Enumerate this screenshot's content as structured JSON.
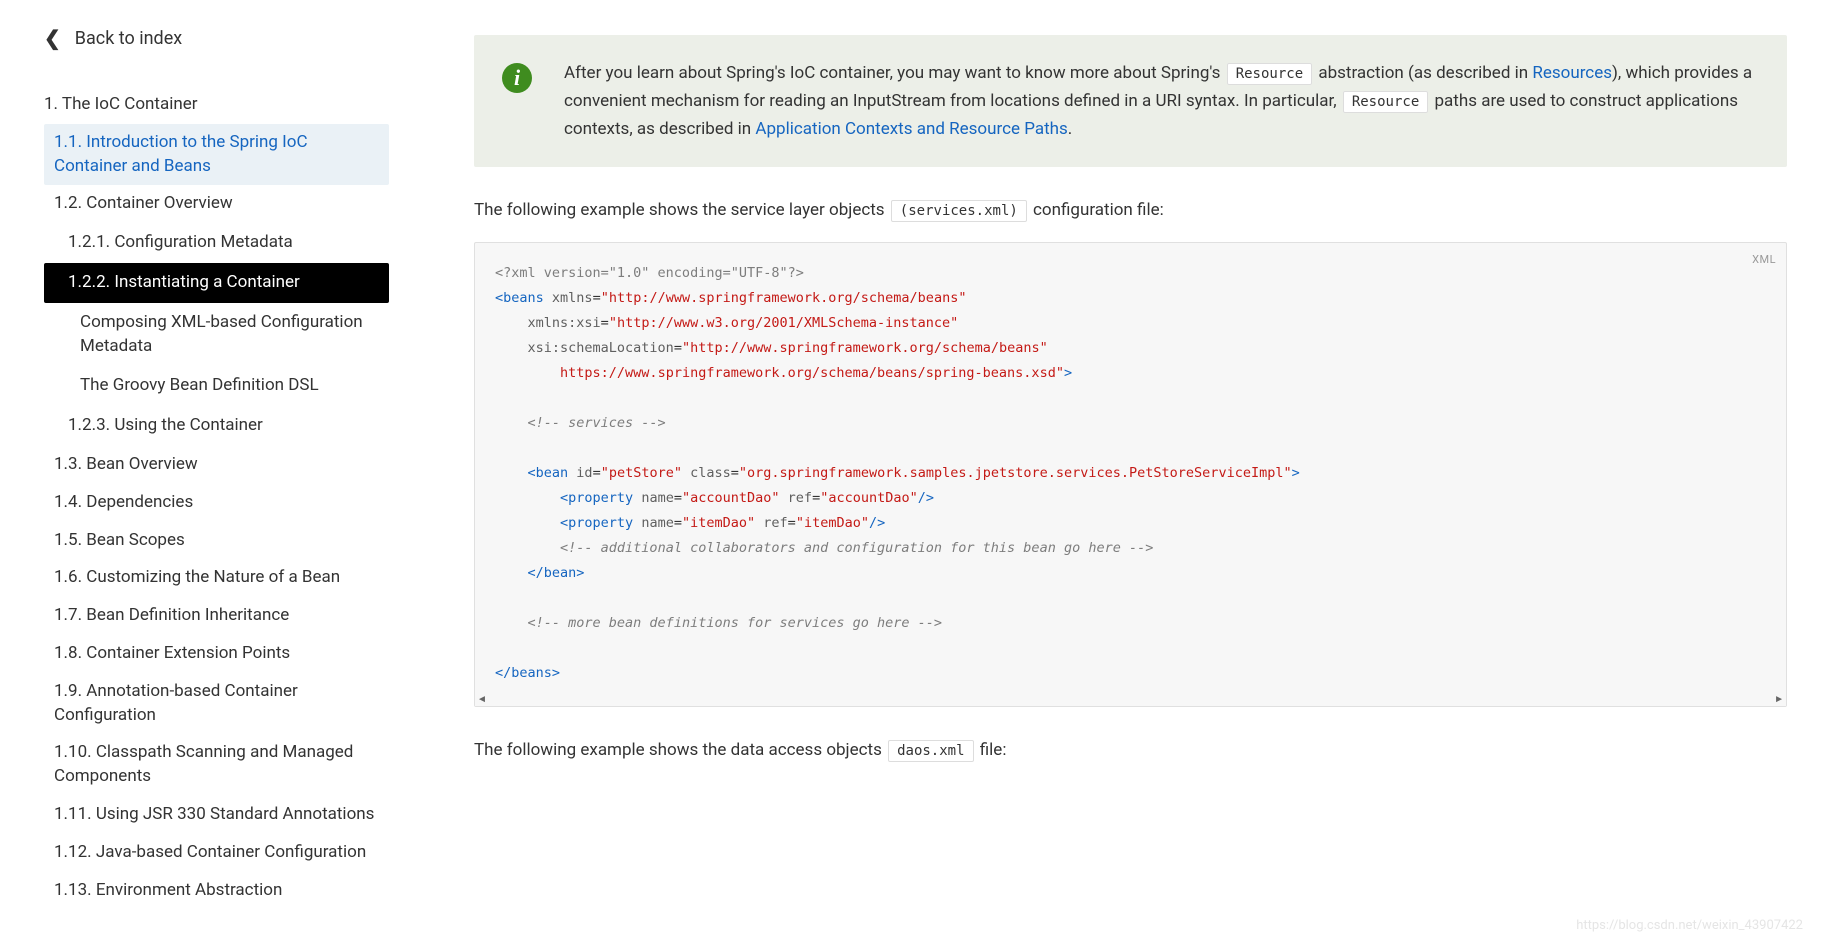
{
  "sidebar": {
    "back_label": "Back to index",
    "items": [
      {
        "label": "1. The IoC Container",
        "level": 0,
        "active": false
      },
      {
        "label": "1.1. Introduction to the Spring IoC Container and Beans",
        "level": 1,
        "active": false,
        "highlight": true
      },
      {
        "label": "1.2. Container Overview",
        "level": 1,
        "active": false
      },
      {
        "label": "1.2.1. Configuration Metadata",
        "level": 2,
        "active": false
      },
      {
        "label": "1.2.2. Instantiating a Container",
        "level": 2,
        "active": true
      },
      {
        "label": "Composing XML-based Configuration Metadata",
        "level": 3,
        "active": false
      },
      {
        "label": "The Groovy Bean Definition DSL",
        "level": 3,
        "active": false
      },
      {
        "label": "1.2.3. Using the Container",
        "level": 2,
        "active": false
      },
      {
        "label": "1.3. Bean Overview",
        "level": 1,
        "active": false
      },
      {
        "label": "1.4. Dependencies",
        "level": 1,
        "active": false
      },
      {
        "label": "1.5. Bean Scopes",
        "level": 1,
        "active": false
      },
      {
        "label": "1.6. Customizing the Nature of a Bean",
        "level": 1,
        "active": false
      },
      {
        "label": "1.7. Bean Definition Inheritance",
        "level": 1,
        "active": false
      },
      {
        "label": "1.8. Container Extension Points",
        "level": 1,
        "active": false
      },
      {
        "label": "1.9. Annotation-based Container Configuration",
        "level": 1,
        "active": false
      },
      {
        "label": "1.10. Classpath Scanning and Managed Components",
        "level": 1,
        "active": false
      },
      {
        "label": "1.11. Using JSR 330 Standard Annotations",
        "level": 1,
        "active": false
      },
      {
        "label": "1.12. Java-based Container Configuration",
        "level": 1,
        "active": false
      },
      {
        "label": "1.13. Environment Abstraction",
        "level": 1,
        "active": false
      }
    ]
  },
  "info": {
    "text_pre": "After you learn about Spring's IoC container, you may want to know more about Spring's ",
    "code1": "Resource",
    "text_mid1": " abstraction (as described in ",
    "link1": "Resources",
    "text_mid2": "), which provides a convenient mechanism for reading an InputStream from locations defined in a URI syntax. In particular, ",
    "code2": "Resource",
    "text_mid3": " paths are used to construct applications contexts, as described in ",
    "link2": "Application Contexts and Resource Paths",
    "text_post": "."
  },
  "para1": {
    "pre": "The following example shows the service layer objects ",
    "code": "(services.xml)",
    "post": " configuration file:"
  },
  "codeblock1": {
    "lang": "XML",
    "lines": [
      {
        "t": "pi",
        "s": "<?xml version=\"1.0\" encoding=\"UTF-8\"?>"
      },
      {
        "t": "open",
        "tag": "beans",
        "attrs": [
          [
            "xmlns",
            "http://www.springframework.org/schema/beans"
          ]
        ]
      },
      {
        "t": "attrline",
        "indent": "    ",
        "attr": "xmlns:xsi",
        "val": "http://www.w3.org/2001/XMLSchema-instance"
      },
      {
        "t": "attrline",
        "indent": "    ",
        "attr": "xsi:schemaLocation",
        "val": "http://www.springframework.org/schema/beans",
        "noclose": true
      },
      {
        "t": "attrcont",
        "indent": "        ",
        "val": "https://www.springframework.org/schema/beans/spring-beans.xsd",
        "close": ">"
      },
      {
        "t": "blank"
      },
      {
        "t": "cmt",
        "indent": "    ",
        "s": "<!-- services -->"
      },
      {
        "t": "blank"
      },
      {
        "t": "open2",
        "indent": "    ",
        "tag": "bean",
        "attrs": [
          [
            "id",
            "petStore"
          ],
          [
            "class",
            "org.springframework.samples.jpetstore.services.PetStoreServiceImpl"
          ]
        ],
        "close": ">"
      },
      {
        "t": "self",
        "indent": "        ",
        "tag": "property",
        "attrs": [
          [
            "name",
            "accountDao"
          ],
          [
            "ref",
            "accountDao"
          ]
        ]
      },
      {
        "t": "self",
        "indent": "        ",
        "tag": "property",
        "attrs": [
          [
            "name",
            "itemDao"
          ],
          [
            "ref",
            "itemDao"
          ]
        ]
      },
      {
        "t": "cmt",
        "indent": "        ",
        "s": "<!-- additional collaborators and configuration for this bean go here -->"
      },
      {
        "t": "closetag",
        "indent": "    ",
        "tag": "bean"
      },
      {
        "t": "blank"
      },
      {
        "t": "cmt",
        "indent": "    ",
        "s": "<!-- more bean definitions for services go here -->"
      },
      {
        "t": "blank"
      },
      {
        "t": "closetag",
        "indent": "",
        "tag": "beans"
      }
    ]
  },
  "para2": {
    "pre": "The following example shows the data access objects ",
    "code": "daos.xml",
    "post": " file:"
  },
  "watermark": "https://blog.csdn.net/weixin_43907422"
}
